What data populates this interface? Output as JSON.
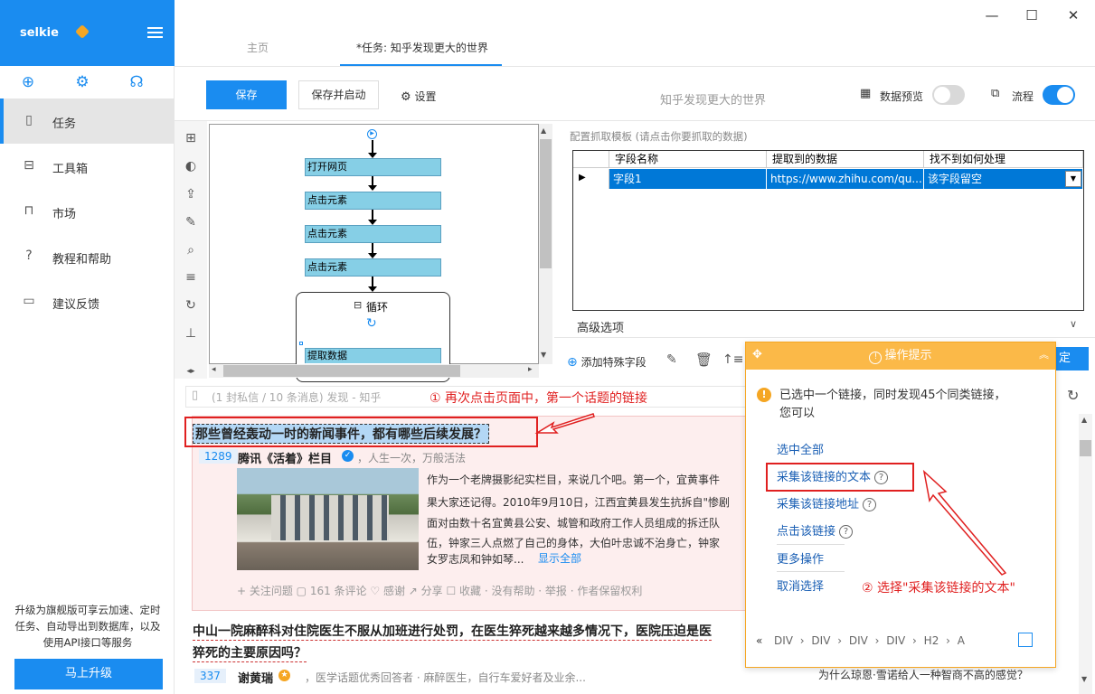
{
  "sidebar": {
    "brand": "selkie",
    "nav": [
      {
        "label": "任务",
        "icon": "document-icon",
        "active": true
      },
      {
        "label": "工具箱",
        "icon": "toolbox-icon"
      },
      {
        "label": "市场",
        "icon": "lock-icon"
      },
      {
        "label": "教程和帮助",
        "icon": "help-icon"
      },
      {
        "label": "建议反馈",
        "icon": "feedback-icon"
      }
    ],
    "upgrade_text": "升级为旗舰版可享云加速、定时任务、自动导出到数据库，以及使用API接口等服务",
    "upgrade_button": "马上升级"
  },
  "tabs": {
    "home": "主页",
    "task": "*任务: 知乎发现更大的世界"
  },
  "toolbar": {
    "save": "保存",
    "save_start": "保存并启动",
    "settings": "设置",
    "task_name": "知乎发现更大的世界",
    "data_preview": "数据预览",
    "flow": "流程",
    "preview_on": false,
    "flow_on": true
  },
  "workflow": {
    "steps": [
      "打开网页",
      "点击元素",
      "点击元素",
      "点击元素"
    ],
    "loop": "循环",
    "extract": "提取数据"
  },
  "config": {
    "title": "配置抓取模板 (请点击你要抓取的数据)",
    "columns": [
      "字段名称",
      "提取到的数据",
      "找不到如何处理"
    ],
    "row": {
      "field": "字段1",
      "data": "https://www.zhihu.com/qu...",
      "handling": "该字段留空"
    },
    "advanced": "高级选项",
    "add_special": "添加特殊字段"
  },
  "browser": {
    "url": "(1 封私信 / 10 条消息) 发现 - 知乎",
    "note1": "① 再次点击页面中，第一个话题的链接",
    "q1": "那些曾经轰动一时的新闻事件，都有哪些后续发展？",
    "votes1": "1289",
    "author1": "腾讯《活着》栏目",
    "bio1": "，人生一次，万般活法",
    "para": [
      "作为一个老牌摄影纪实栏目，来说几个吧。第一个，宜黄事件",
      "果大家还记得。2010年9月10日，江西宜黄县发生抗拆自\"惨剧",
      "面对由数十名宜黄县公安、城管和政府工作人员组成的拆迁队",
      "伍，钟家三人点燃了自己的身体，大伯叶忠诚不治身亡，钟家",
      "女罗志凤和钟如琴..."
    ],
    "show_all": "显示全部",
    "actions1": "+ 关注问题   ▢ 161 条评论   ♡ 感谢   ↗ 分享   ☐ 收藏 · 没有帮助 · 举报 · 作者保留权利",
    "q2_line1": "中山一院麻醉科对住院医生不服从加班进行处罚，在医生猝死越来越多情况下，医院压迫是医",
    "q2_line2": "猝死的主要原因吗？",
    "votes2": "337",
    "author2": "谢黄瑞",
    "bio2": "，医学话题优秀回答者 · 麻醉医生，自行车爱好者及业余...",
    "side_link": "为什么琼恩·雪诺给人一种智商不高的感觉？"
  },
  "popup": {
    "title": "操作提示",
    "message": "已选中一个链接，同时发现45个同类链接，您可以",
    "options": [
      "选中全部",
      "采集该链接的文本",
      "采集该链接地址",
      "点击该链接",
      "更多操作",
      "取消选择"
    ],
    "note2": "② 选择\"采集该链接的文本\"",
    "crumbs": "DIV › DIV › DIV › DIV › H2 › A",
    "partial_button": "定"
  }
}
